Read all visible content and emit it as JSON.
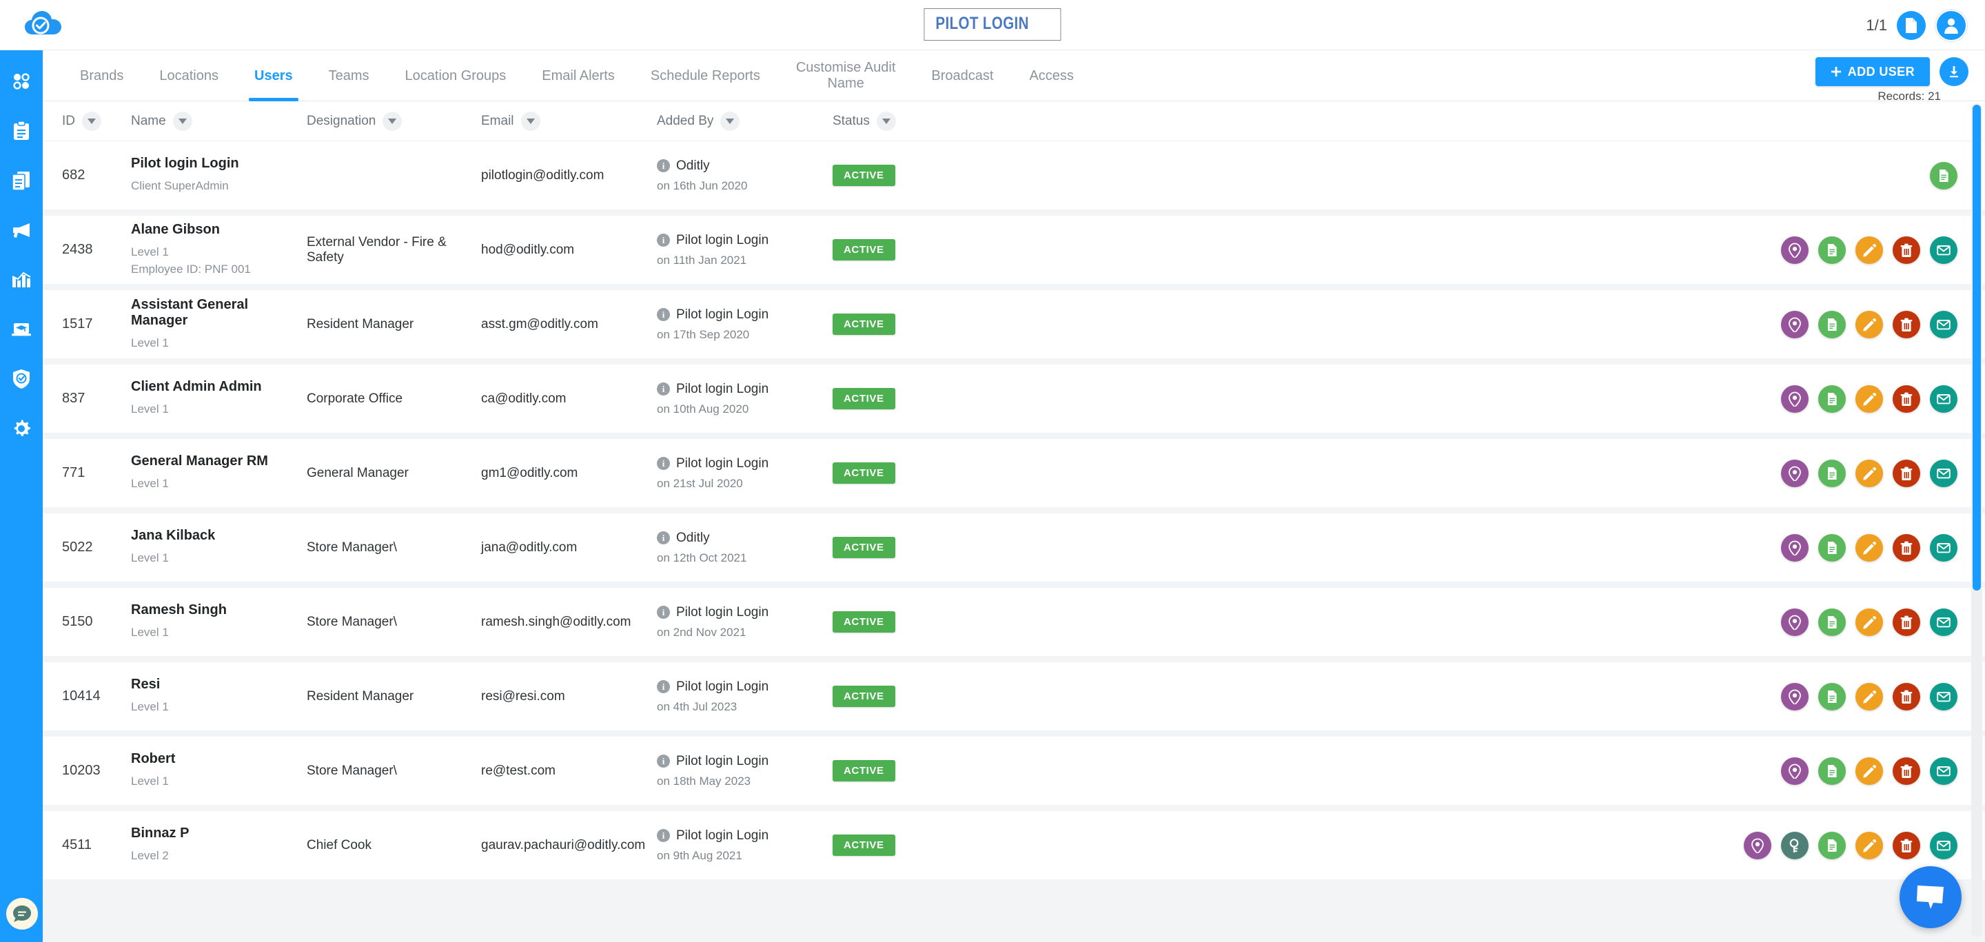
{
  "header": {
    "logo_icon": "cloud-check-icon",
    "title": "PILOT LOGIN",
    "page_count": "1/1",
    "doc_icon": "document-icon",
    "avatar_icon": "user-avatar-icon"
  },
  "sidebar": {
    "items": [
      {
        "icon": "dashboard-dots-icon",
        "label": "Dashboard"
      },
      {
        "icon": "clipboard-icon",
        "label": "Audits"
      },
      {
        "icon": "documents-icon",
        "label": "Reports"
      },
      {
        "icon": "megaphone-icon",
        "label": "Broadcast"
      },
      {
        "icon": "bar-chart-icon",
        "label": "Analytics"
      },
      {
        "icon": "training-laptop-icon",
        "label": "Training"
      },
      {
        "icon": "shield-check-icon",
        "label": "Compliance"
      },
      {
        "icon": "gear-icon",
        "label": "Settings"
      }
    ],
    "chat_icon": "chat-bubble-icon"
  },
  "nav": {
    "tabs": [
      {
        "label": "Brands",
        "active": false
      },
      {
        "label": "Locations",
        "active": false
      },
      {
        "label": "Users",
        "active": true
      },
      {
        "label": "Teams",
        "active": false
      },
      {
        "label": "Location Groups",
        "active": false
      },
      {
        "label": "Email Alerts",
        "active": false
      },
      {
        "label": "Schedule Reports",
        "active": false
      },
      {
        "label": "Customise Audit\nName",
        "active": false
      },
      {
        "label": "Broadcast",
        "active": false
      },
      {
        "label": "Access",
        "active": false
      }
    ],
    "add_user_label": "ADD USER",
    "add_user_icon": "plus-icon",
    "download_icon": "download-icon",
    "records_label": "Records: 21"
  },
  "table": {
    "columns": [
      {
        "label": "ID",
        "key": "id"
      },
      {
        "label": "Name",
        "key": "name"
      },
      {
        "label": "Designation",
        "key": "designation"
      },
      {
        "label": "Email",
        "key": "email"
      },
      {
        "label": "Added By",
        "key": "added_by"
      },
      {
        "label": "Status",
        "key": "status"
      }
    ],
    "status_color": "#4caf50",
    "action_colors": {
      "location": "#96549b",
      "key": "#4f8077",
      "document": "#5cb85c",
      "edit": "#f0a020",
      "delete": "#c0350c",
      "email": "#0e9c8c"
    },
    "rows": [
      {
        "id": "682",
        "name": "Pilot login Login",
        "level": "Client SuperAdmin",
        "employee_id": "",
        "designation": "",
        "email": "pilotlogin@oditly.com",
        "added_by": "Oditly",
        "added_on": "on 16th Jun 2020",
        "status": "ACTIVE",
        "actions": [
          "document"
        ]
      },
      {
        "id": "2438",
        "name": "Alane Gibson",
        "level": "Level 1",
        "employee_id": "Employee ID: PNF 001",
        "designation": "External Vendor - Fire & Safety",
        "email": "hod@oditly.com",
        "added_by": "Pilot login Login",
        "added_on": "on 11th Jan 2021",
        "status": "ACTIVE",
        "actions": [
          "location",
          "document",
          "edit",
          "delete",
          "email"
        ]
      },
      {
        "id": "1517",
        "name": "Assistant General Manager",
        "level": "Level 1",
        "employee_id": "",
        "designation": "Resident Manager",
        "email": "asst.gm@oditly.com",
        "added_by": "Pilot login Login",
        "added_on": "on 17th Sep 2020",
        "status": "ACTIVE",
        "actions": [
          "location",
          "document",
          "edit",
          "delete",
          "email"
        ]
      },
      {
        "id": "837",
        "name": "Client Admin Admin",
        "level": "Level 1",
        "employee_id": "",
        "designation": "Corporate Office",
        "email": "ca@oditly.com",
        "added_by": "Pilot login Login",
        "added_on": "on 10th Aug 2020",
        "status": "ACTIVE",
        "actions": [
          "location",
          "document",
          "edit",
          "delete",
          "email"
        ]
      },
      {
        "id": "771",
        "name": "General Manager RM",
        "level": "Level 1",
        "employee_id": "",
        "designation": "General Manager",
        "email": "gm1@oditly.com",
        "added_by": "Pilot login Login",
        "added_on": "on 21st Jul 2020",
        "status": "ACTIVE",
        "actions": [
          "location",
          "document",
          "edit",
          "delete",
          "email"
        ]
      },
      {
        "id": "5022",
        "name": "Jana Kilback",
        "level": "Level 1",
        "employee_id": "",
        "designation": "Store Manager\\",
        "email": "jana@oditly.com",
        "added_by": "Oditly",
        "added_on": "on 12th Oct 2021",
        "status": "ACTIVE",
        "actions": [
          "location",
          "document",
          "edit",
          "delete",
          "email"
        ]
      },
      {
        "id": "5150",
        "name": "Ramesh Singh",
        "level": "Level 1",
        "employee_id": "",
        "designation": "Store Manager\\",
        "email": "ramesh.singh@oditly.com",
        "added_by": "Pilot login Login",
        "added_on": "on 2nd Nov 2021",
        "status": "ACTIVE",
        "actions": [
          "location",
          "document",
          "edit",
          "delete",
          "email"
        ]
      },
      {
        "id": "10414",
        "name": "Resi",
        "level": "Level 1",
        "employee_id": "",
        "designation": "Resident Manager",
        "email": "resi@resi.com",
        "added_by": "Pilot login Login",
        "added_on": "on 4th Jul 2023",
        "status": "ACTIVE",
        "actions": [
          "location",
          "document",
          "edit",
          "delete",
          "email"
        ]
      },
      {
        "id": "10203",
        "name": "Robert",
        "level": "Level 1",
        "employee_id": "",
        "designation": "Store Manager\\",
        "email": "re@test.com",
        "added_by": "Pilot login Login",
        "added_on": "on 18th May 2023",
        "status": "ACTIVE",
        "actions": [
          "location",
          "document",
          "edit",
          "delete",
          "email"
        ]
      },
      {
        "id": "4511",
        "name": "Binnaz P",
        "level": "Level 2",
        "employee_id": "",
        "designation": "Chief Cook",
        "email": "gaurav.pachauri@oditly.com",
        "added_by": "Pilot login Login",
        "added_on": "on 9th Aug 2021",
        "status": "ACTIVE",
        "actions": [
          "location",
          "key",
          "document",
          "edit",
          "delete",
          "email"
        ]
      }
    ]
  },
  "chat_widget": {
    "icon": "chat-bubble-icon"
  }
}
